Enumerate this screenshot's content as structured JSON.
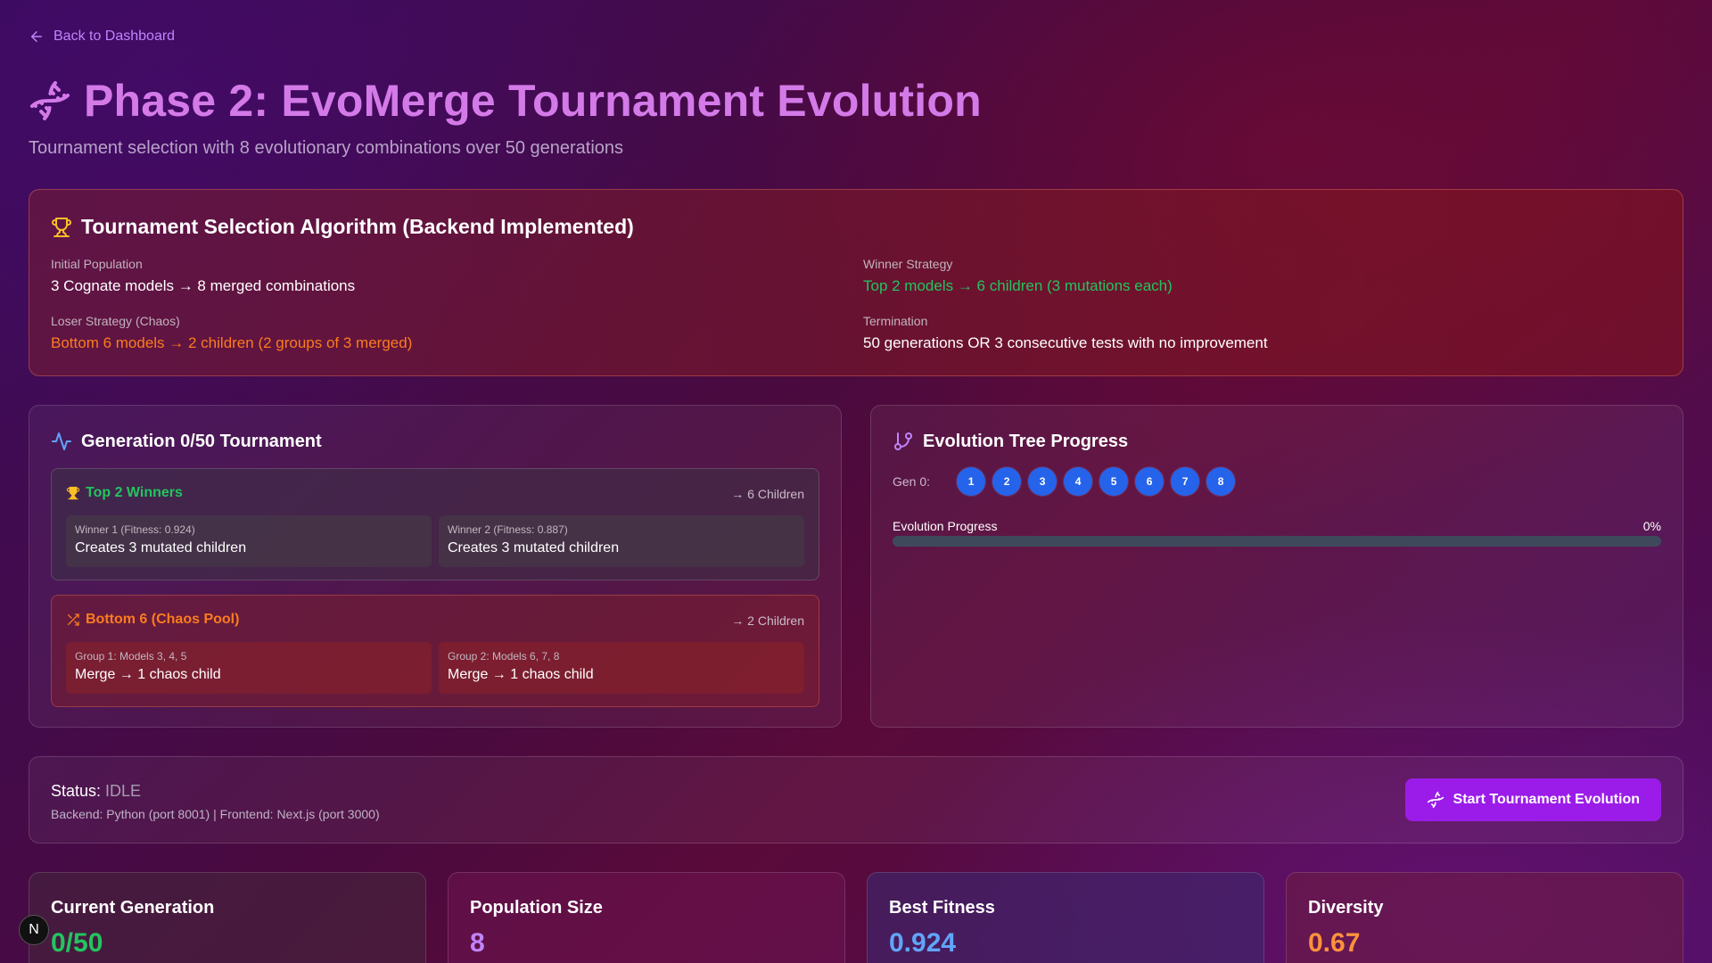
{
  "nav": {
    "back_label": "Back to Dashboard"
  },
  "header": {
    "title": "Phase 2: EvoMerge Tournament Evolution",
    "subtitle": "Tournament selection with 8 evolutionary combinations over 50 generations"
  },
  "algorithm": {
    "title": "Tournament Selection Algorithm (Backend Implemented)",
    "initial_population": {
      "label": "Initial Population",
      "value": "3 Cognate models → 8 merged combinations"
    },
    "winner_strategy": {
      "label": "Winner Strategy",
      "value": "Top 2 models → 6 children (3 mutations each)"
    },
    "loser_strategy": {
      "label": "Loser Strategy (Chaos)",
      "value": "Bottom 6 models → 2 children (2 groups of 3 merged)"
    },
    "termination": {
      "label": "Termination",
      "value": "50 generations OR 3 consecutive tests with no improvement"
    }
  },
  "generation": {
    "title": "Generation 0/50 Tournament",
    "winners": {
      "title": "Top 2 Winners",
      "children": "→ 6 Children",
      "items": [
        {
          "label": "Winner 1 (Fitness: 0.924)",
          "value": "Creates 3 mutated children"
        },
        {
          "label": "Winner 2 (Fitness: 0.887)",
          "value": "Creates 3 mutated children"
        }
      ]
    },
    "losers": {
      "title": "Bottom 6 (Chaos Pool)",
      "children": "→ 2 Children",
      "items": [
        {
          "label": "Group 1: Models 3, 4, 5",
          "value": "Merge → 1 chaos child"
        },
        {
          "label": "Group 2: Models 6, 7, 8",
          "value": "Merge → 1 chaos child"
        }
      ]
    }
  },
  "tree": {
    "title": "Evolution Tree Progress",
    "gen_label": "Gen 0:",
    "nodes": [
      "1",
      "2",
      "3",
      "4",
      "5",
      "6",
      "7",
      "8"
    ],
    "progress_label": "Evolution Progress",
    "progress_text": "0%",
    "progress_fraction": 0
  },
  "status": {
    "label": "Status:",
    "value": "IDLE",
    "detail": "Backend: Python (port 8001) | Frontend: Next.js (port 3000)",
    "button_label": "Start Tournament Evolution"
  },
  "stats": [
    {
      "title": "Current Generation",
      "value": "0/50",
      "color": "#22c55e"
    },
    {
      "title": "Population Size",
      "value": "8",
      "color": "#c084fc"
    },
    {
      "title": "Best Fitness",
      "value": "0.924",
      "color": "#60a5fa"
    },
    {
      "title": "Diversity",
      "value": "0.67",
      "color": "#fb923c"
    }
  ],
  "badge": "N",
  "colors": {
    "accent": "#9b1ce8",
    "title": "#d47ae8",
    "node": "#2563eb",
    "green": "#22c55e",
    "orange": "#fb7c1e"
  }
}
